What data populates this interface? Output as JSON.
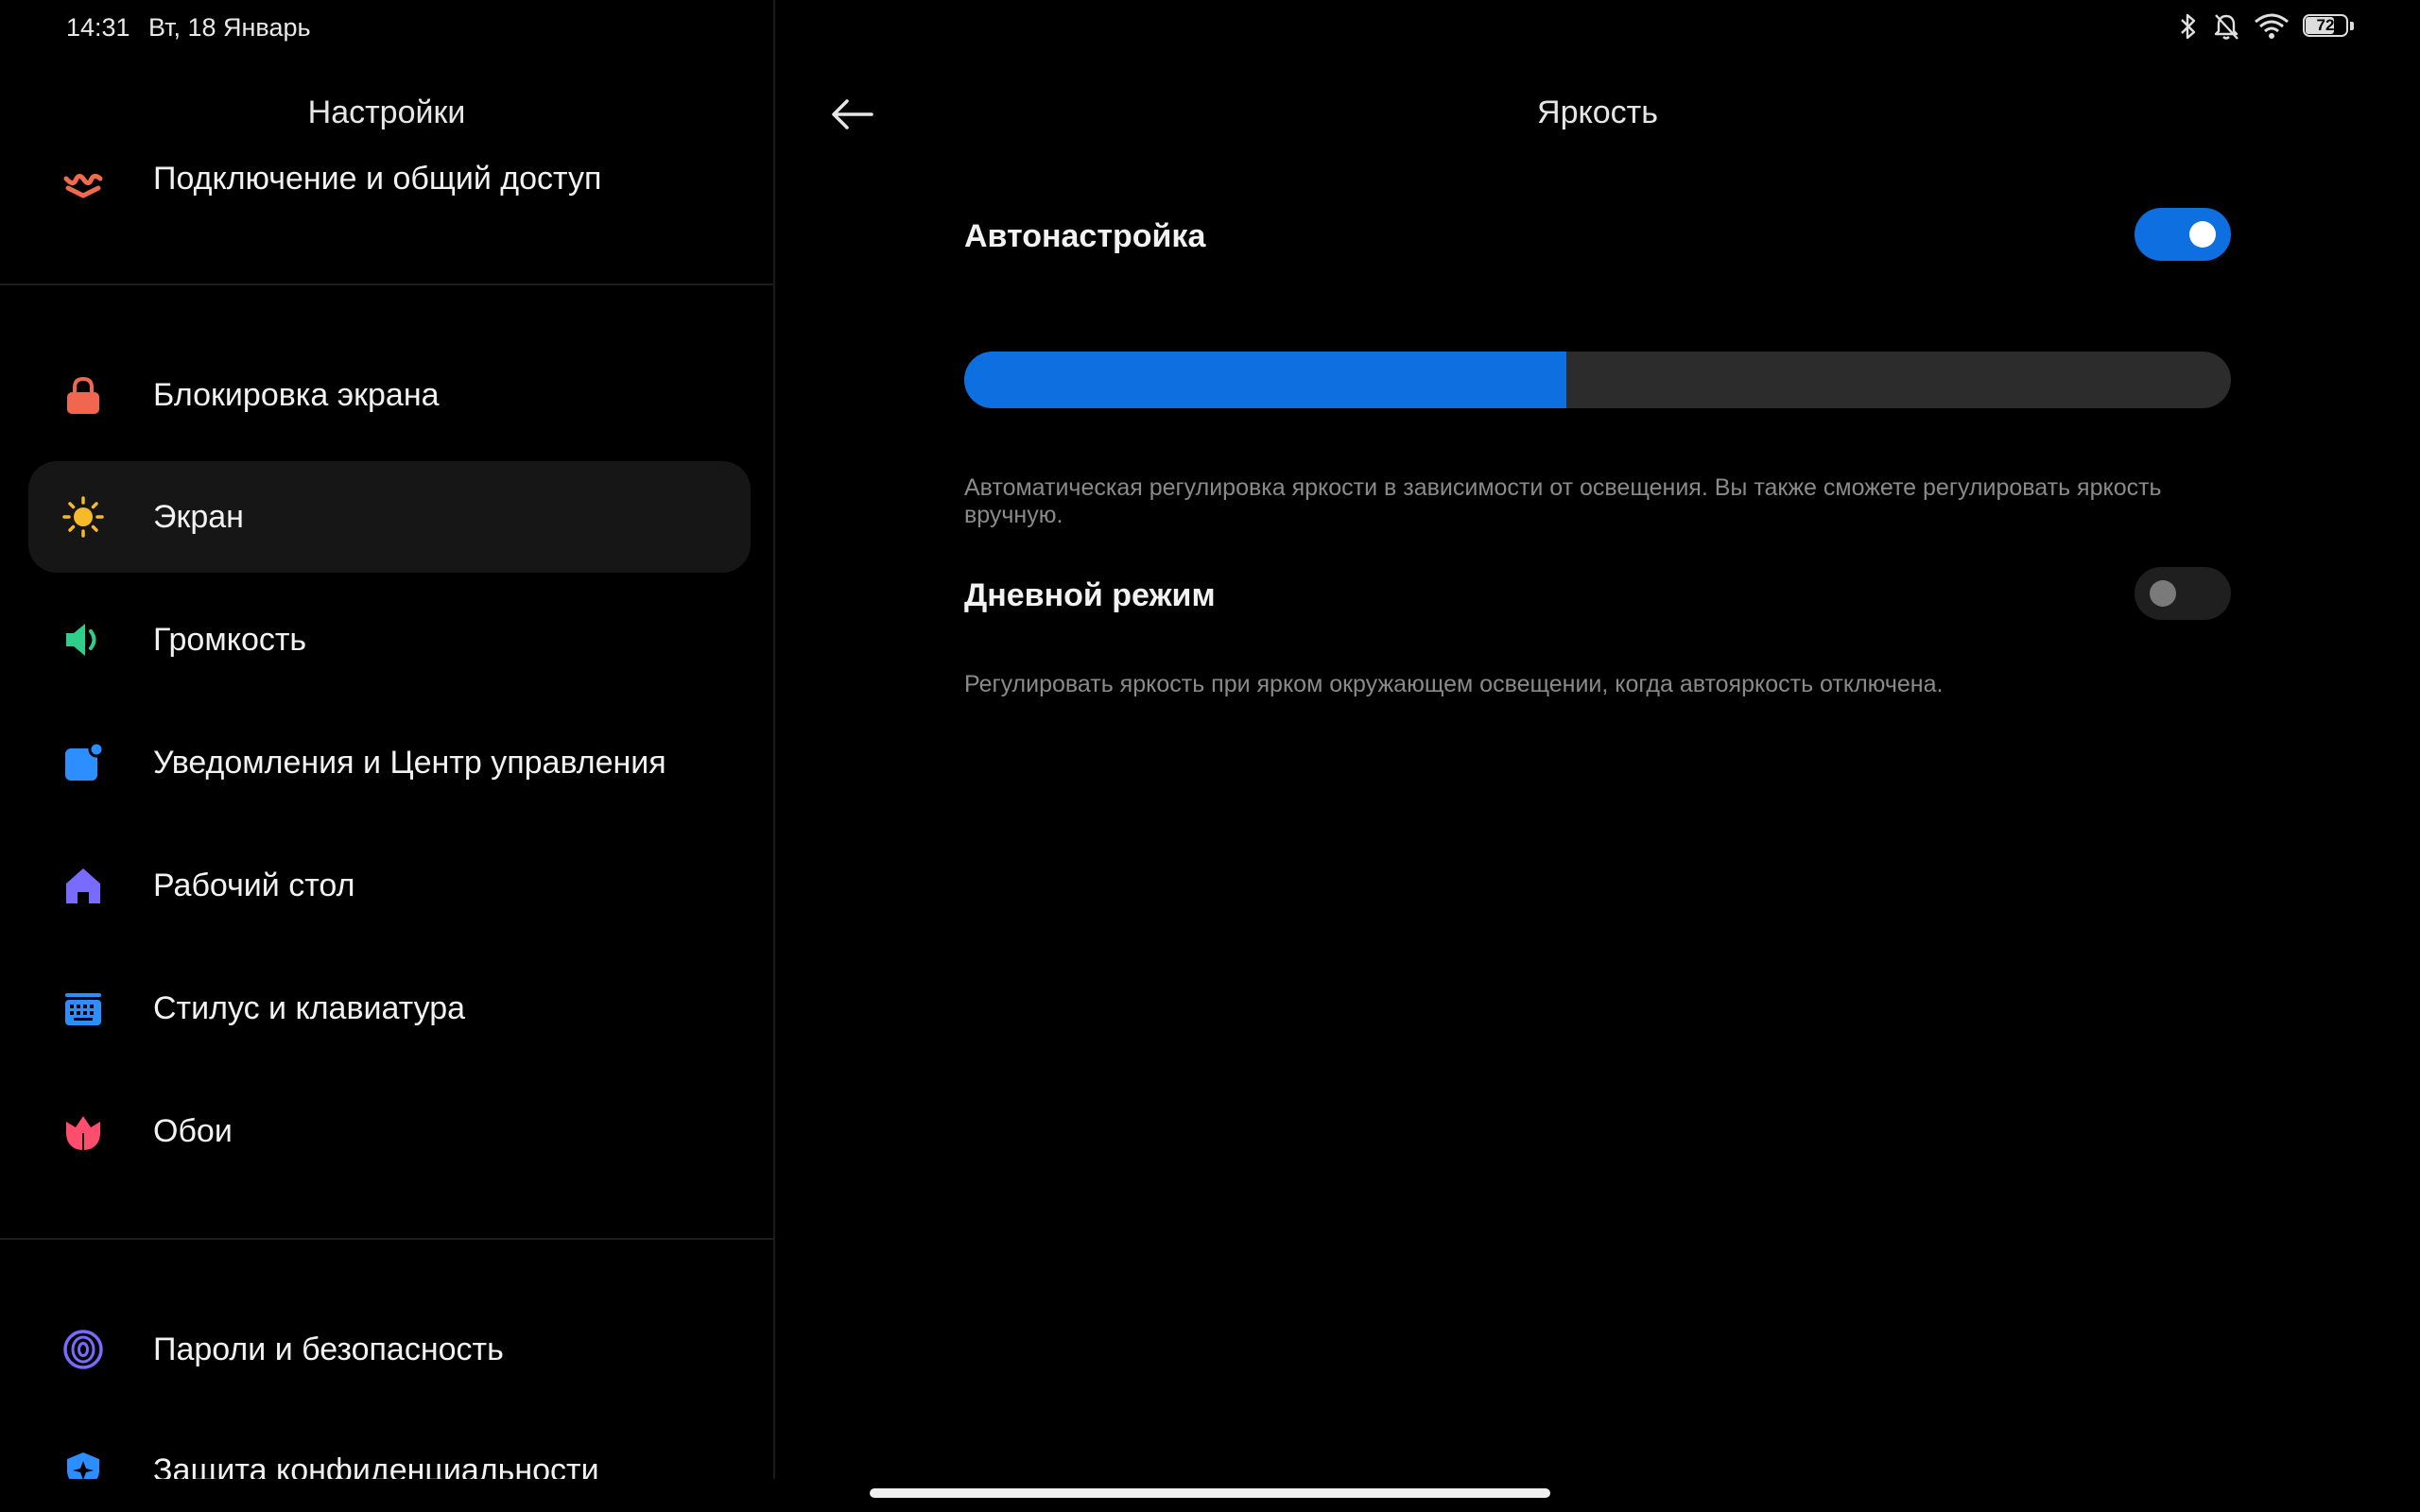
{
  "status_bar": {
    "time": "14:31",
    "date": "Вт, 18 Январь",
    "battery_level": "72"
  },
  "left_pane": {
    "title": "Настройки",
    "items": [
      {
        "label": "Подключение и общий доступ",
        "icon": "connection-sharing-icon",
        "color": "#f06a4c"
      },
      {
        "label": "Блокировка экрана",
        "icon": "lock-icon",
        "color": "#f1664f"
      },
      {
        "label": "Экран",
        "icon": "sun-icon",
        "color": "#f6b92a",
        "selected": true
      },
      {
        "label": "Громкость",
        "icon": "speaker-icon",
        "color": "#2fcf8b"
      },
      {
        "label": "Уведомления и Центр управления",
        "icon": "notification-icon",
        "color": "#2d8fff"
      },
      {
        "label": "Рабочий стол",
        "icon": "home-icon",
        "color": "#7a6bff"
      },
      {
        "label": "Стилус и клавиатура",
        "icon": "keyboard-icon",
        "color": "#2d8fff"
      },
      {
        "label": "Обои",
        "icon": "tulip-icon",
        "color": "#ff4d6d"
      },
      {
        "label": "Пароли и безопасность",
        "icon": "fingerprint-icon",
        "color": "#7a6bff"
      },
      {
        "label": "Защита конфиденциальности",
        "icon": "privacy-shield-icon",
        "color": "#2d8fff"
      }
    ]
  },
  "right_pane": {
    "title": "Яркость",
    "auto": {
      "label": "Автонастройка",
      "enabled": true,
      "description": "Автоматическая регулировка яркости в зависимости от освещения. Вы также сможете регулировать яркость вручную."
    },
    "brightness_level": 0.475,
    "daylight": {
      "label": "Дневной режим",
      "enabled": false,
      "description": "Регулировать яркость при ярком окружающем освещении, когда автояркость отключена."
    }
  },
  "colors": {
    "accent": "#0d6fe0",
    "background": "#000000"
  }
}
